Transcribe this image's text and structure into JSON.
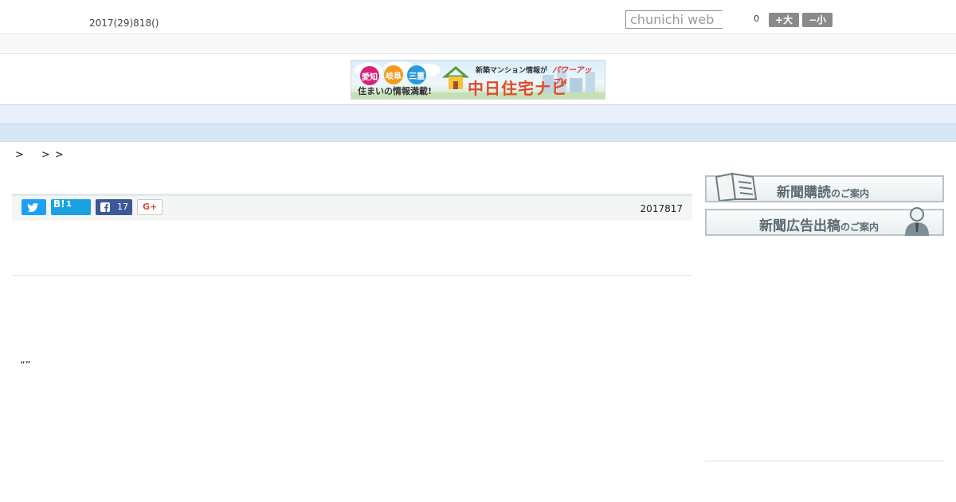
{
  "header": {
    "date": "2017(29)818()",
    "search_placeholder": "chunichi web",
    "font_size": {
      "count": "0",
      "increase_label": "+大",
      "decrease_label": "−小"
    }
  },
  "banner": {
    "tag_aichi": "愛知",
    "tag_gifu": "岐阜",
    "tag_mie": "三重",
    "tagline": "住まいの情報満載!",
    "headline": "新築マンション情報が",
    "power_up": "パワーアップ!!",
    "brand": "中日住宅ナビ"
  },
  "nav": {
    "items": [
      "",
      "",
      "",
      "",
      "",
      "",
      "",
      "",
      ""
    ]
  },
  "breadcrumb": {
    "separators": [
      ">",
      ">",
      ">"
    ]
  },
  "share": {
    "hatena_label": "B!",
    "hatena_count": "1",
    "facebook_count": "17",
    "google_label": "G+",
    "article_date": "2017817"
  },
  "article": {
    "quote": "“”"
  },
  "sidebar": {
    "subscribe_main": "新聞購読",
    "subscribe_sub": "のご案内",
    "advert_main": "新聞広告出稿",
    "advert_sub": "のご案内"
  },
  "colors": {
    "nav_bg": "#e8f1fa",
    "twitter": "#1da1f2",
    "hatena": "#1aa1e1",
    "facebook": "#3b5998",
    "google": "#dd4b39"
  }
}
